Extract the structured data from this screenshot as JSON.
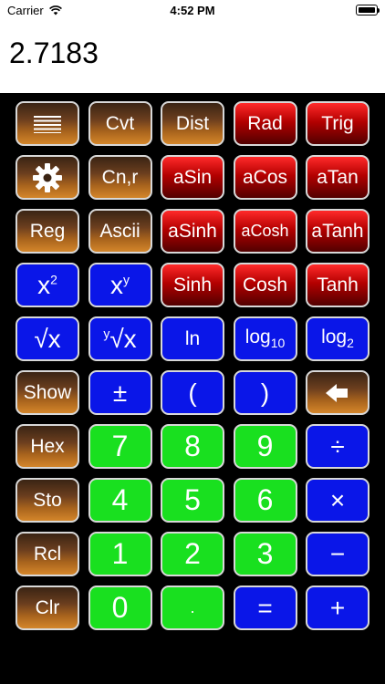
{
  "status": {
    "carrier": "Carrier",
    "time": "4:52 PM"
  },
  "display": {
    "value": "2.7183"
  },
  "icons": {
    "menu": "menu-icon",
    "settings": "gear-icon",
    "backspace": "backspace-arrow-icon",
    "wifi": "wifi-icon",
    "battery": "battery-icon"
  },
  "colors": {
    "brown": "#a9641d",
    "red": "#b40000",
    "blue": "#0a16e8",
    "green": "#19e01f",
    "background": "#000000"
  },
  "keys": {
    "cvt": "Cvt",
    "dist": "Dist",
    "rad": "Rad",
    "trig": "Trig",
    "cnr": "Cn,r",
    "asin": "aSin",
    "acos": "aCos",
    "atan": "aTan",
    "reg": "Reg",
    "ascii": "Ascii",
    "asinh": "aSinh",
    "acosh": "aCosh",
    "atanh": "aTanh",
    "x_base": "x",
    "x_square_exp": "2",
    "xy_exp": "y",
    "sinh": "Sinh",
    "cosh": "Cosh",
    "tanh": "Tanh",
    "sqrt_radicand": "√x",
    "yroot_index": "y",
    "ln": "ln",
    "log_base": "log",
    "log10_sub": "10",
    "log2_sub": "2",
    "show": "Show",
    "plusminus": "±",
    "lparen": "(",
    "rparen": ")",
    "hex": "Hex",
    "seven": "7",
    "eight": "8",
    "nine": "9",
    "divide": "÷",
    "sto": "Sto",
    "four": "4",
    "five": "5",
    "six": "6",
    "multiply": "×",
    "rcl": "Rcl",
    "one": "1",
    "two": "2",
    "three": "3",
    "minus": "−",
    "clr": "Clr",
    "zero": "0",
    "dot": ".",
    "equals": "=",
    "plus": "+"
  }
}
